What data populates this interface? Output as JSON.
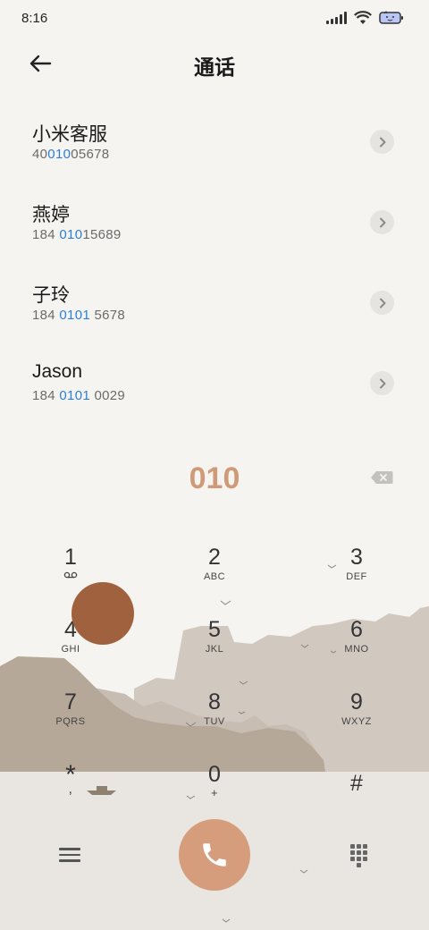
{
  "status": {
    "time": "8:16"
  },
  "header": {
    "title": "通话"
  },
  "contacts": [
    {
      "name": "小米客服",
      "number_pre": "40",
      "number_hl": "010",
      "number_post": "05678"
    },
    {
      "name": "燕婷",
      "number_pre": "184 ",
      "number_hl": "010",
      "number_post": "15689"
    },
    {
      "name": "子玲",
      "number_pre": "184 ",
      "number_hl": "0101",
      "number_post": " 5678"
    },
    {
      "name": "Jason",
      "number_pre": "184 ",
      "number_hl": "0101",
      "number_post": " 0029"
    }
  ],
  "dial": {
    "input": "010"
  },
  "keys": [
    {
      "digit": "1",
      "letters": ""
    },
    {
      "digit": "2",
      "letters": "ABC"
    },
    {
      "digit": "3",
      "letters": "DEF"
    },
    {
      "digit": "4",
      "letters": "GHI"
    },
    {
      "digit": "5",
      "letters": "JKL"
    },
    {
      "digit": "6",
      "letters": "MNO"
    },
    {
      "digit": "7",
      "letters": "PQRS"
    },
    {
      "digit": "8",
      "letters": "TUV"
    },
    {
      "digit": "9",
      "letters": "WXYZ"
    },
    {
      "digit": "*",
      "letters": ","
    },
    {
      "digit": "0",
      "letters": "+"
    },
    {
      "digit": "#",
      "letters": ""
    }
  ],
  "colors": {
    "accent": "#d69d7c",
    "dial_text": "#cf9a78",
    "highlight": "#2b7fd9",
    "touch": "#a0623e"
  }
}
